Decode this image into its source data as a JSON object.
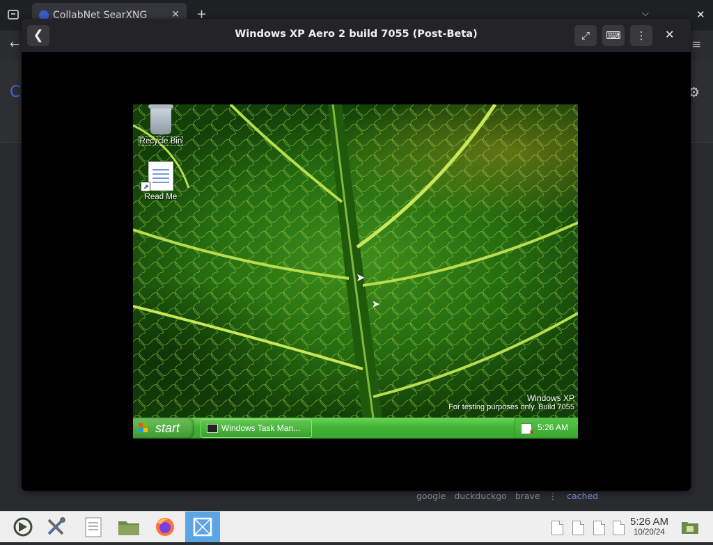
{
  "browser": {
    "tab_title": "CollabNet SearXNG",
    "new_tab_symbol": "+",
    "close_symbol": "✕",
    "dropdown_symbol": "⌵",
    "back_symbol": "←",
    "menu_symbol": "≡",
    "logo_fragment": "C",
    "gear_symbol": "⚙"
  },
  "search_engines": {
    "items": [
      "google",
      "duckduckgo",
      "brave"
    ],
    "separator": "⋮",
    "cached_label": "cached"
  },
  "modal": {
    "title": "Windows XP Aero 2 build 7055 (Post-Beta)",
    "back_symbol": "❮",
    "fullscreen_symbol": "⤢",
    "keyboard_symbol": "⌨",
    "more_symbol": "⋮",
    "close_symbol": "✕"
  },
  "vm": {
    "desktop_icons": [
      {
        "label": "Recycle Bin"
      },
      {
        "label": "Read Me"
      }
    ],
    "watermark": {
      "line1": "Windows XP",
      "line2": "For testing purposes only. Build 7055"
    },
    "taskbar": {
      "start_label": "start",
      "task_button_label": "Windows Task Man...",
      "clock": "5:26 AM"
    }
  },
  "host_taskbar": {
    "apps": [
      "kde-plasma-icon",
      "settings-tools-icon",
      "text-editor-icon",
      "file-manager-icon",
      "firefox-icon",
      "window-switcher-icon"
    ],
    "time": "5:26 AM",
    "date": "10/20/24"
  },
  "colors": {
    "accent_link": "#7a8fd8",
    "xp_taskbar": "#3fb433",
    "active_task": "#5ba5e4"
  }
}
